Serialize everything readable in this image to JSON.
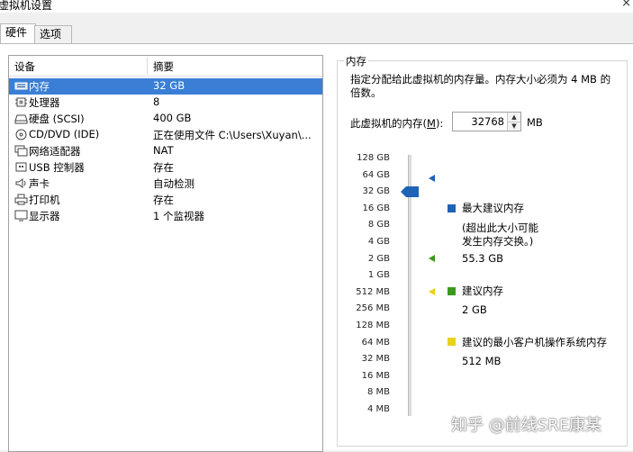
{
  "window": {
    "title": "虚拟机设置",
    "close_glyph": "×"
  },
  "tabs": [
    {
      "label": "硬件"
    },
    {
      "label": "选项"
    }
  ],
  "device_list": {
    "headers": {
      "device": "设备",
      "summary": "摘要"
    },
    "rows": [
      {
        "icon": "memory-icon",
        "device": "内存",
        "summary": "32 GB",
        "selected": true
      },
      {
        "icon": "cpu-icon",
        "device": "处理器",
        "summary": "8"
      },
      {
        "icon": "harddisk-icon",
        "device": "硬盘 (SCSI)",
        "summary": "400 GB"
      },
      {
        "icon": "cd-dvd-icon",
        "device": "CD/DVD (IDE)",
        "summary": "正在使用文件 C:\\Users\\Xuyan\\..."
      },
      {
        "icon": "network-icon",
        "device": "网络适配器",
        "summary": "NAT"
      },
      {
        "icon": "usb-icon",
        "device": "USB 控制器",
        "summary": "存在"
      },
      {
        "icon": "sound-icon",
        "device": "声卡",
        "summary": "自动检测"
      },
      {
        "icon": "printer-icon",
        "device": "打印机",
        "summary": "存在"
      },
      {
        "icon": "display-icon",
        "device": "显示器",
        "summary": "1 个监视器"
      }
    ]
  },
  "memory": {
    "group_title": "内存",
    "description": "指定分配给此虚拟机的内存量。内存大小必须为 4 MB 的倍数。",
    "label_prefix": "此虚拟机的内存(",
    "label_key": "M",
    "label_suffix": "):",
    "value": "32768",
    "unit": "MB",
    "scale_labels": [
      "128 GB",
      "64 GB",
      "32 GB",
      "16 GB",
      "8 GB",
      "4 GB",
      "2 GB",
      "1 GB",
      "512 MB",
      "256 MB",
      "128 MB",
      "64 MB",
      "32 MB",
      "16 MB",
      "8 MB",
      "4 MB"
    ],
    "current_level": "32 GB",
    "legend": {
      "max": {
        "title": "最大建议内存",
        "note_line1": "(超出此大小可能",
        "note_line2": "发生内存交换。)",
        "value": "55.3 GB",
        "color": "#1e63b5"
      },
      "recommended": {
        "title": "建议内存",
        "value": "2 GB",
        "color": "#3a9a1f"
      },
      "min_guest": {
        "title": "建议的最小客户机操作系统内存",
        "value": "512 MB",
        "color": "#e8d21a"
      }
    }
  },
  "watermark": "知乎 @前线SRE康某"
}
